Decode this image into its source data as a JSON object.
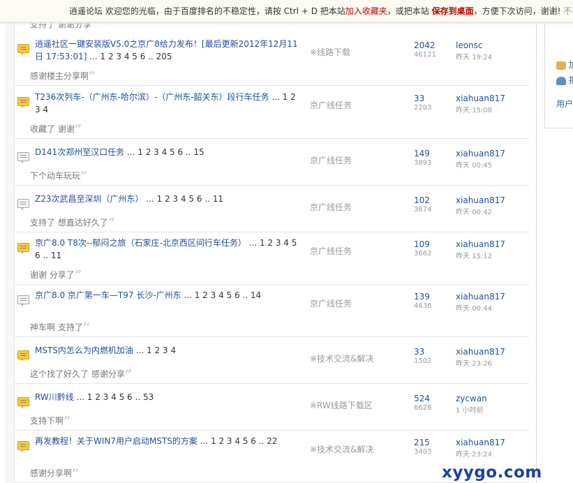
{
  "notice": {
    "site": "逍遥论坛",
    "text1": "欢迎您的光临，由于百度排名的不稳定性，请按 Ctrl + D 把本站",
    "link1": "加入收藏夹",
    "text2": "，或把本站",
    "link2": "保存到桌面",
    "text3": "，方便下次访问，谢谢!",
    "close": "不再"
  },
  "side_panel": {
    "item1": "加",
    "item2": "报",
    "user": "用户"
  },
  "top_quote": "支持了 谢谢分享",
  "threads": [
    {
      "title": "逍遥社区一键安装版V5.0之京广8给力发布！[最后更新2012年12月11日 17:53:01]",
      "pages": "... 1 2 3 4 5 6 .. 205",
      "icon": "hot",
      "forum": "※线路下载",
      "replies": "2042",
      "views": "46121",
      "last_user": "leonsc",
      "last_time": "昨天 19:24",
      "quote": "感谢楼主分享啊"
    },
    {
      "title": "T236次列车-（广州东-哈尔滨）-（广州东-韶关东）段行车任务",
      "pages": "... 1 2 3 4",
      "icon": "hot",
      "forum": "京广线任务",
      "replies": "33",
      "views": "2203",
      "last_user": "xiahuan817",
      "last_time": "昨天 15:08",
      "quote": "收藏了 谢谢"
    },
    {
      "title": "D141次郑州至汉口任务",
      "pages": "... 1 2 3 4 5 6 .. 15",
      "icon": "normal",
      "forum": "京广线任务",
      "replies": "149",
      "views": "3893",
      "last_user": "xiahuan817",
      "last_time": "昨天 00:45",
      "quote": "下个动车玩玩"
    },
    {
      "title": "Z23次武昌至深圳（广州东）",
      "pages": "... 1 2 3 4 5 6 .. 11",
      "icon": "normal",
      "forum": "京广线任务",
      "replies": "102",
      "views": "3674",
      "last_user": "xiahuan817",
      "last_time": "昨天 00:42",
      "quote": "支持了 想直达好久了"
    },
    {
      "title": "京广8.0 T8次--郁闷之旅（石家庄-北京西区间行车任务）",
      "pages": "... 1 2 3 4 5 6 .. 11",
      "icon": "hot",
      "forum": "京广线任务",
      "replies": "109",
      "views": "3662",
      "last_user": "xiahuan817",
      "last_time": "昨天 15:12",
      "quote": "谢谢 分享了"
    },
    {
      "title": "京广8.0 京广第一车—T97 长沙-广州东",
      "pages": "... 1 2 3 4 5 6 .. 14",
      "icon": "normal",
      "forum": "京广线任务",
      "replies": "139",
      "views": "4636",
      "last_user": "xiahuan817",
      "last_time": "昨天 00:44",
      "quote": "神车啊 支持了"
    },
    {
      "title": "MSTS内怎么为内燃机加油",
      "pages": "... 1 2 3 4",
      "icon": "hot",
      "forum": "※技术交流&解决",
      "replies": "33",
      "views": "1502",
      "last_user": "xiahuan817",
      "last_time": "昨天 23:26",
      "quote": "这个找了好久了 感谢分享"
    },
    {
      "title": "RW川黔线",
      "pages": "... 1 2 3 4 5 6 .. 53",
      "icon": "hot",
      "forum": "※RW线路下载区",
      "replies": "524",
      "views": "6628",
      "last_user": "zycwan",
      "last_time": "1 小时前",
      "quote": "支持下啊"
    },
    {
      "title": "再发教程！关于WIN7用户启动MSTS的方案",
      "pages": "... 1 2 3 4 5 6 .. 22",
      "icon": "hot",
      "forum": "※技术交流&解决",
      "replies": "215",
      "views": "3403",
      "last_user": "xiahuan817",
      "last_time": "昨天 23:24",
      "quote": "感谢分享啊"
    }
  ],
  "watermark": "xyygo.com"
}
